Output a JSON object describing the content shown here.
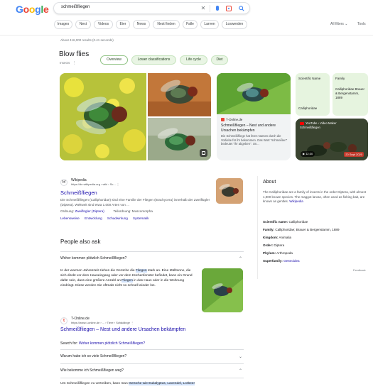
{
  "header": {
    "logo": "Google",
    "search_query": "schmeißfliegen",
    "chips": [
      "Images",
      "Next",
      "Videos",
      "Eier",
      "News",
      "Nest finden",
      "Falle",
      "Larven",
      "Loswerden"
    ],
    "all_filters": "All filters",
    "tools": "Tools"
  },
  "result_stats": "About 416,000 results (0.41 seconds)",
  "knowledge_panel": {
    "title": "Blow flies",
    "subtitle": "Insects",
    "tabs": [
      "Overview",
      "Lower classifications",
      "Life cycle",
      "Diet"
    ],
    "card": {
      "source": "T-Online.de",
      "title": "Schmeißfliegen – Nest und andere Ursachen bekämpfen",
      "snippet": "Die Schmeißfliege hat ihren Namen durch die Vorliebe für ihr bekommen. Das Wort \"schmeißen\" bedeutet \"ihr abgeben\". Un..."
    },
    "facts": {
      "scientific_name_label": "Scientific Name",
      "scientific_name_value": "Calliphoridae",
      "family_label": "Family",
      "family_value": "Calliphoridae Brauer & Bergenstamm, 1889"
    },
    "video": {
      "source": "YouTube › Video Maker",
      "title": "Schmeißfliegen",
      "duration": "12:30",
      "date": "20 Sept 2020"
    }
  },
  "wiki_result": {
    "site": "Wikipedia",
    "url": "https://de.wikipedia.org › wiki › Sc...",
    "title": "Schmeißfliegen",
    "snippet": "Die Schmeißfliegen (Calliphoridae) sind eine Familie der Fliegen (Brachycera) innerhalb der Zweiflügler (Diptera). Weltweit sind etwa 1.000 Arten von ...",
    "order_label": "Ordnung:",
    "order_value": "Zweiflügler (Diptera)",
    "suborder_label": "Teilordnung:",
    "suborder_value": "Muscomorpha",
    "links": [
      "Lebensweise",
      "Entwicklung",
      "Schadwirkung",
      "Systematik"
    ]
  },
  "paa": {
    "title": "People also ask",
    "q1": "Woher kommen plötzlich Schmeißfliegen?",
    "answer_1a": "In der warmen Jahreszeit ziehen die Gerüche die ",
    "answer_hl": "Fliegen",
    "answer_1b": " stark an. Eine Mülltonne, die sich direkt vor dem Hauseingang oder vor dem Küchenfenster befindet, kann ein Grund dafür sein, dass eine größere Anzahl an ",
    "answer_hl2": "Fliegen",
    "answer_1c": " in das Haus oder in die Wohnung eindringt. Diese werden Sie oftmals nicht so schnell wieder los.",
    "source_site": "T-Online.de",
    "source_url": "https://www.t-online.de › ... › Tiere › Schädlinge",
    "source_title": "Schmeißfliegen – Nest und andere Ursachen bekämpfen",
    "search_for_label": "Search for: ",
    "search_for_link": "Woher kommen plötzlich Schmeißfliegen?",
    "q2": "Warum habe ich so viele Schmeißfliegen?",
    "q3": "Wie bekomme ich Schmeißfliegen weg?",
    "answer_3a": "Um Schmeißfliegen zu vertreiben, kann man ",
    "answer_3hl": "Gerüche wie Eukalyptus, Lavendel, Lorbeer"
  },
  "about": {
    "title": "About",
    "text": "The Calliphoridae are a family of insects in the order Diptera, with almost 1,900 known species. The maggot larvae, often used as fishing bait, are known as gentles.",
    "wiki_link": "Wikipedia",
    "facts": [
      {
        "label": "Scientific name:",
        "value": "Calliphoridae"
      },
      {
        "label": "Family:",
        "value": "Calliphoridae; Brauer & Bergenstamm, 1889"
      },
      {
        "label": "Kingdom:",
        "value": "Animalia"
      },
      {
        "label": "Order:",
        "value": "Diptera"
      },
      {
        "label": "Phylum:",
        "value": "Arthropoda"
      },
      {
        "label": "Superfamily:",
        "value": "Oestroidea"
      }
    ],
    "feedback": "Feedback"
  }
}
